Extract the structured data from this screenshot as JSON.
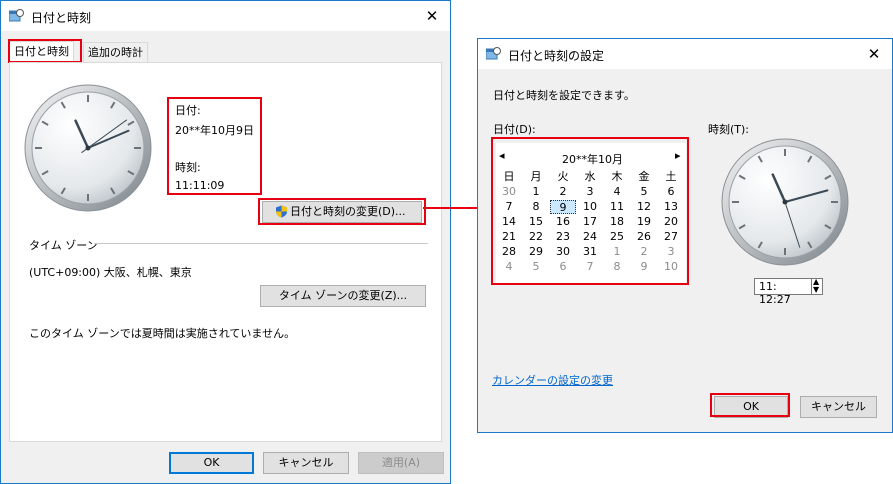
{
  "left_window": {
    "title": "日付と時刻",
    "tabs": [
      "日付と時刻",
      "追加の時計"
    ],
    "date_label": "日付:",
    "date_value": "20**年10月9日",
    "time_label": "時刻:",
    "time_value": "11:11:09",
    "change_datetime_button": "日付と時刻の変更(D)...",
    "timezone_header": "タイム ゾーン",
    "timezone_value": "(UTC+09:00) 大阪、札幌、東京",
    "change_timezone_button": "タイム ゾーンの変更(Z)...",
    "dst_note": "このタイム ゾーンでは夏時間は実施されていません。",
    "ok_button": "OK",
    "cancel_button": "キャンセル",
    "apply_button": "適用(A)",
    "clock": {
      "hour": 11,
      "minute": 11,
      "second": 9
    }
  },
  "right_window": {
    "title": "日付と時刻の設定",
    "instruction": "日付と時刻を設定できます。",
    "date_label": "日付(D):",
    "time_label": "時刻(T):",
    "calendar": {
      "month_title": "20**年10月",
      "prev": "◂",
      "next": "▸",
      "weekdays": [
        "日",
        "月",
        "火",
        "水",
        "木",
        "金",
        "土"
      ],
      "rows": [
        [
          "30",
          "1",
          "2",
          "3",
          "4",
          "5",
          "6"
        ],
        [
          "7",
          "8",
          "9",
          "10",
          "11",
          "12",
          "13"
        ],
        [
          "14",
          "15",
          "16",
          "17",
          "18",
          "19",
          "20"
        ],
        [
          "21",
          "22",
          "23",
          "24",
          "25",
          "26",
          "27"
        ],
        [
          "28",
          "29",
          "30",
          "31",
          "1",
          "2",
          "3"
        ],
        [
          "4",
          "5",
          "6",
          "7",
          "8",
          "9",
          "10"
        ]
      ],
      "selected": "9"
    },
    "time_input": "11: 12:27",
    "calendar_settings_link": "カレンダーの設定の変更",
    "ok_button": "OK",
    "cancel_button": "キャンセル",
    "clock": {
      "hour": 11,
      "minute": 12,
      "second": 27
    }
  },
  "colors": {
    "highlight": "#e60012",
    "accent": "#0078d7",
    "link": "#0066cc"
  }
}
